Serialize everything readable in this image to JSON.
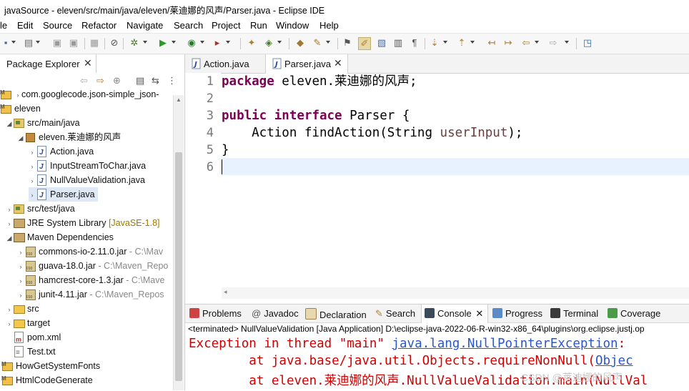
{
  "window": {
    "title": "javaSource - eleven/src/main/java/eleven/莱迪娜的风声/Parser.java - Eclipse IDE"
  },
  "menu": [
    "le",
    "Edit",
    "Source",
    "Refactor",
    "Navigate",
    "Search",
    "Project",
    "Run",
    "Window",
    "Help"
  ],
  "package_explorer": {
    "title": "Package Explorer",
    "close": "✕",
    "tree": [
      {
        "label": "com.googlecode.json-simple_json-",
        "path": ""
      },
      {
        "label": "eleven",
        "path": ""
      },
      {
        "label": "src/main/java",
        "path": ""
      },
      {
        "label": "eleven.莱迪娜的风声",
        "path": ""
      },
      {
        "label": "Action.java",
        "path": ""
      },
      {
        "label": "InputStreamToChar.java",
        "path": ""
      },
      {
        "label": "NullValueValidation.java",
        "path": ""
      },
      {
        "label": "Parser.java",
        "path": ""
      },
      {
        "label": "src/test/java",
        "path": ""
      },
      {
        "label": "JRE System Library",
        "path": "[JavaSE-1.8]"
      },
      {
        "label": "Maven Dependencies",
        "path": ""
      },
      {
        "label": "commons-io-2.11.0.jar",
        "path": "- C:\\Mav"
      },
      {
        "label": "guava-18.0.jar",
        "path": "- C:\\Maven_Repo"
      },
      {
        "label": "hamcrest-core-1.3.jar",
        "path": "- C:\\Mave"
      },
      {
        "label": "junit-4.11.jar",
        "path": "- C:\\Maven_Repos"
      },
      {
        "label": "src",
        "path": ""
      },
      {
        "label": "target",
        "path": ""
      },
      {
        "label": "pom.xml",
        "path": ""
      },
      {
        "label": "Test.txt",
        "path": ""
      },
      {
        "label": "HowGetSystemFonts",
        "path": ""
      },
      {
        "label": "HtmlCodeGenerate",
        "path": ""
      }
    ]
  },
  "editor": {
    "tabs": [
      {
        "label": "Action.java"
      },
      {
        "label": "Parser.java",
        "close": "✕"
      }
    ],
    "line_numbers": [
      "1",
      "2",
      "3",
      "4",
      "5",
      "6"
    ],
    "code": {
      "l1_kw": "package",
      "l1_rest": " eleven.莱迪娜的风声;",
      "l3_kw1": "public",
      "l3_kw2": "interface",
      "l3_rest": " Parser {",
      "l4_a": "    Action findAction(String ",
      "l4_param": "userInput",
      "l4_b": ");",
      "l5": "}"
    }
  },
  "console": {
    "tabs": [
      "Problems",
      "Javadoc",
      "Declaration",
      "Search",
      "Console",
      "Progress",
      "Terminal",
      "Coverage"
    ],
    "close": "✕",
    "at_symbol": "@",
    "status": "<terminated> NullValueValidation [Java Application] D:\\eclipse-java-2022-06-R-win32-x86_64\\plugins\\org.eclipse.justj.op",
    "line1_prefix": "Exception in thread \"main\" ",
    "line1_link": "java.lang.NullPointerException",
    "line1_suffix": ": ",
    "line2_prefix": "        at java.base/java.util.Objects.requireNonNull(",
    "line2_link": "Objec",
    "line3_text": "        at eleven.莱迪娜的风声.NullValueValidation.main(NullVal"
  },
  "watermark": "CSDN @莱迪娜的风声"
}
